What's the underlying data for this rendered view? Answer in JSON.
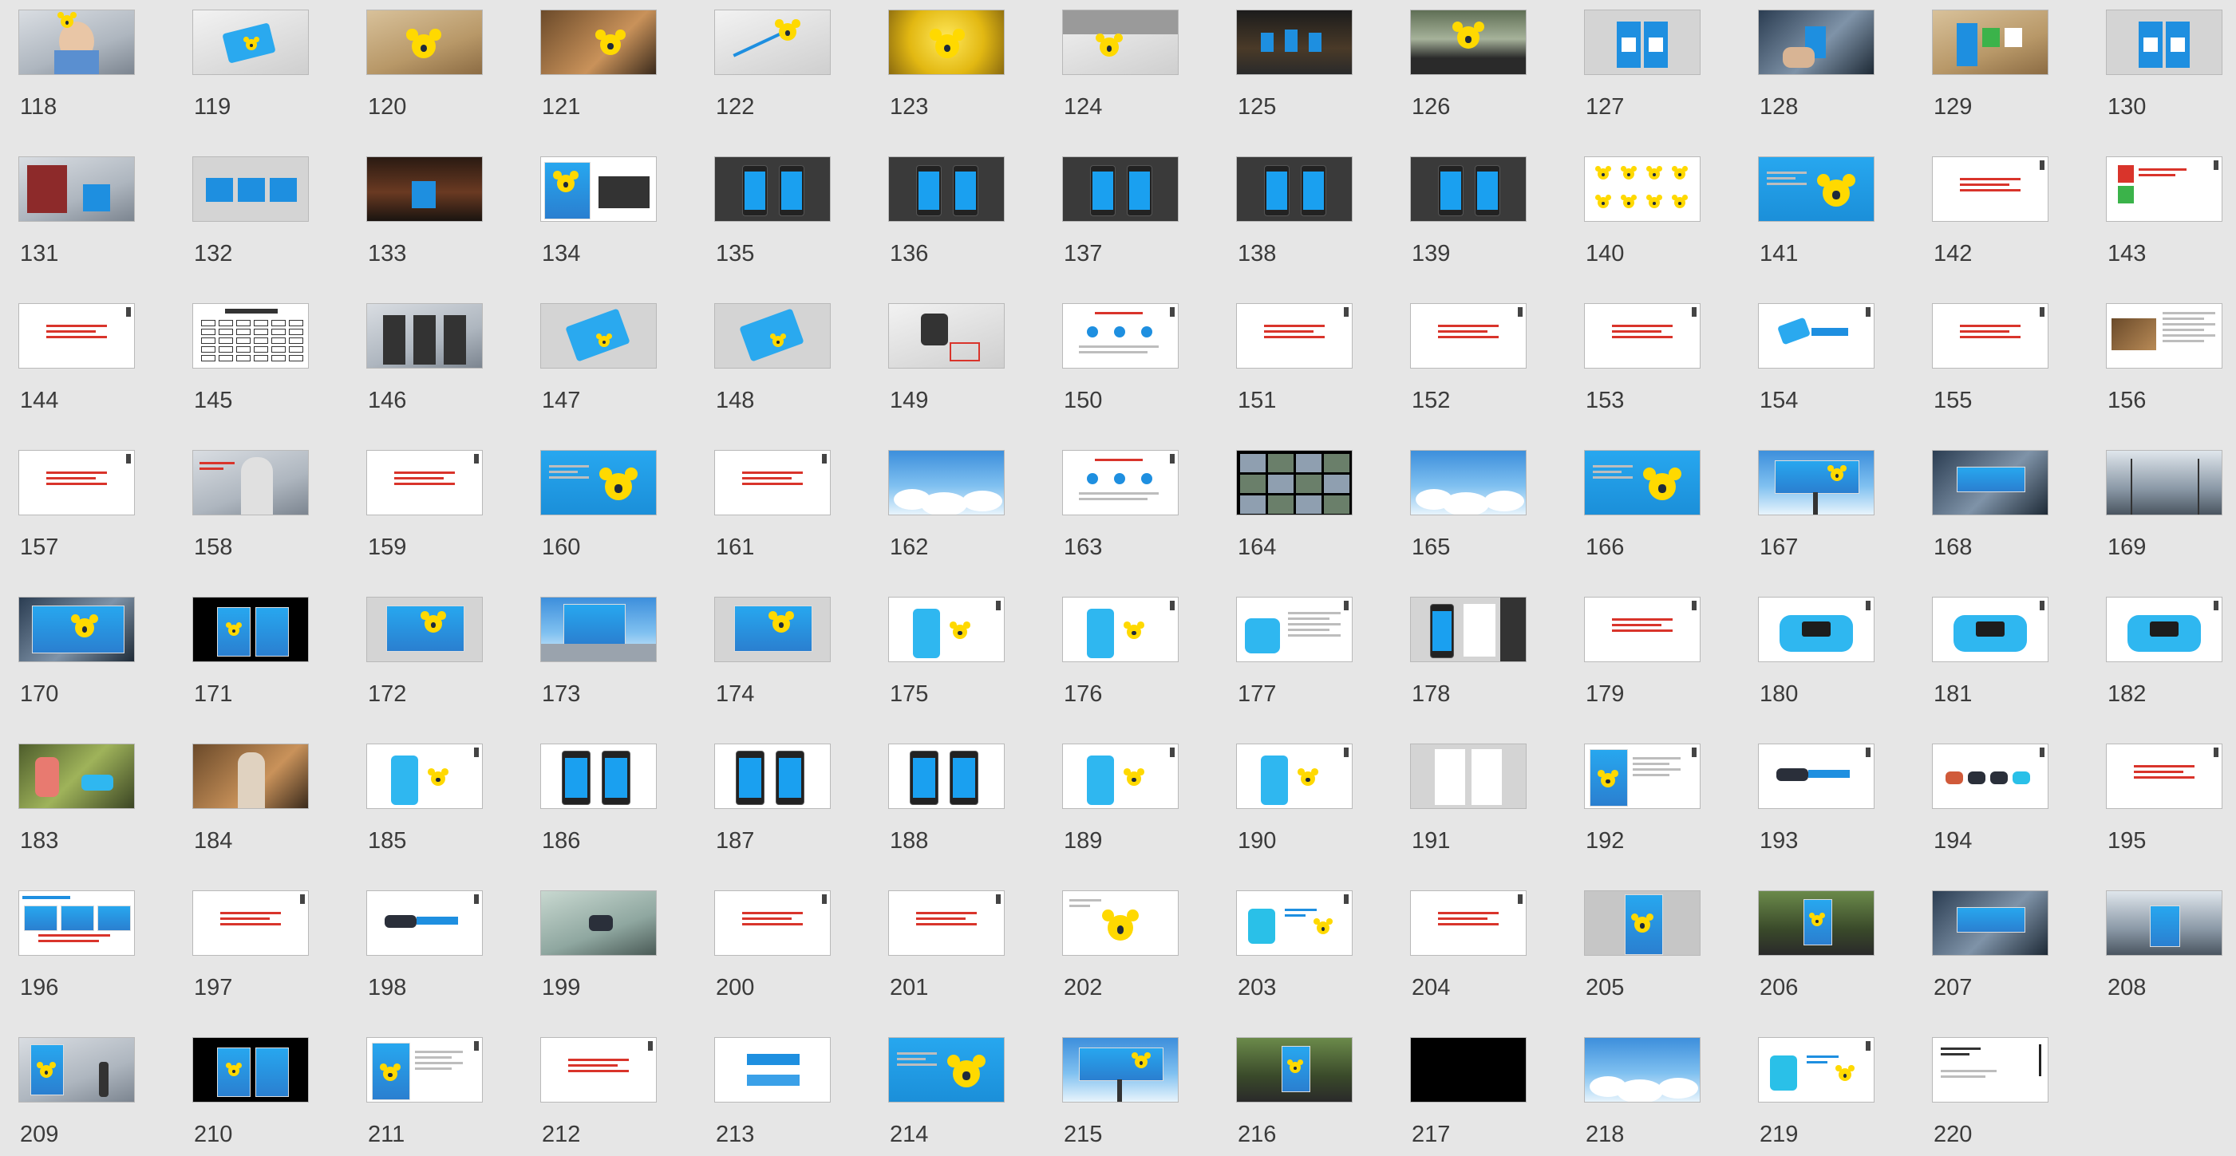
{
  "slides": [
    {
      "num": "118",
      "kind": "photo-girl"
    },
    {
      "num": "119",
      "kind": "card-desk"
    },
    {
      "num": "120",
      "kind": "keychain-wood"
    },
    {
      "num": "121",
      "kind": "keychain-warm"
    },
    {
      "num": "122",
      "kind": "keychain-desk"
    },
    {
      "num": "123",
      "kind": "yellow-glow"
    },
    {
      "num": "124",
      "kind": "keychain-laptop"
    },
    {
      "num": "125",
      "kind": "counter-dark"
    },
    {
      "num": "126",
      "kind": "car-dash"
    },
    {
      "num": "127",
      "kind": "qr-stand"
    },
    {
      "num": "128",
      "kind": "photo-hand"
    },
    {
      "num": "129",
      "kind": "qr-stand-wood"
    },
    {
      "num": "130",
      "kind": "qr-stand"
    },
    {
      "num": "131",
      "kind": "photo-store"
    },
    {
      "num": "132",
      "kind": "push-pull"
    },
    {
      "num": "133",
      "kind": "photo-dark"
    },
    {
      "num": "134",
      "kind": "poster-laptop"
    },
    {
      "num": "135",
      "kind": "phones-dark"
    },
    {
      "num": "136",
      "kind": "phones-dark"
    },
    {
      "num": "137",
      "kind": "phones-dark"
    },
    {
      "num": "138",
      "kind": "phones-dark"
    },
    {
      "num": "139",
      "kind": "phones-dark"
    },
    {
      "num": "140",
      "kind": "koalas-white"
    },
    {
      "num": "141",
      "kind": "koala-blue"
    },
    {
      "num": "142",
      "kind": "text-white"
    },
    {
      "num": "143",
      "kind": "arrows-white"
    },
    {
      "num": "144",
      "kind": "text-white"
    },
    {
      "num": "145",
      "kind": "org-chart"
    },
    {
      "num": "146",
      "kind": "atm-photo"
    },
    {
      "num": "147",
      "kind": "card-grey"
    },
    {
      "num": "148",
      "kind": "card-grey"
    },
    {
      "num": "149",
      "kind": "stamp"
    },
    {
      "num": "150",
      "kind": "diagram-white"
    },
    {
      "num": "151",
      "kind": "text-white"
    },
    {
      "num": "152",
      "kind": "text-white"
    },
    {
      "num": "153",
      "kind": "text-white"
    },
    {
      "num": "154",
      "kind": "card-white"
    },
    {
      "num": "155",
      "kind": "text-white"
    },
    {
      "num": "156",
      "kind": "photo-text"
    },
    {
      "num": "157",
      "kind": "text-white"
    },
    {
      "num": "158",
      "kind": "photo-woman"
    },
    {
      "num": "159",
      "kind": "text-white"
    },
    {
      "num": "160",
      "kind": "koala-blue"
    },
    {
      "num": "161",
      "kind": "text-white"
    },
    {
      "num": "162",
      "kind": "sky"
    },
    {
      "num": "163",
      "kind": "diagram-white"
    },
    {
      "num": "164",
      "kind": "grid-photos"
    },
    {
      "num": "165",
      "kind": "sky"
    },
    {
      "num": "166",
      "kind": "koala-blue"
    },
    {
      "num": "167",
      "kind": "billboard"
    },
    {
      "num": "168",
      "kind": "billboard-indoor"
    },
    {
      "num": "169",
      "kind": "corridor"
    },
    {
      "num": "170",
      "kind": "lightbox"
    },
    {
      "num": "171",
      "kind": "lightbox-dark"
    },
    {
      "num": "172",
      "kind": "poster-wall"
    },
    {
      "num": "173",
      "kind": "building"
    },
    {
      "num": "174",
      "kind": "poster-wall"
    },
    {
      "num": "175",
      "kind": "pos-white"
    },
    {
      "num": "176",
      "kind": "pos-white"
    },
    {
      "num": "177",
      "kind": "pos-text"
    },
    {
      "num": "178",
      "kind": "phones-grey"
    },
    {
      "num": "179",
      "kind": "text-white"
    },
    {
      "num": "180",
      "kind": "device-white"
    },
    {
      "num": "181",
      "kind": "device-white"
    },
    {
      "num": "182",
      "kind": "device-white"
    },
    {
      "num": "183",
      "kind": "photo-green"
    },
    {
      "num": "184",
      "kind": "photo-shop"
    },
    {
      "num": "185",
      "kind": "pos-white"
    },
    {
      "num": "186",
      "kind": "phones-white"
    },
    {
      "num": "187",
      "kind": "phones-white"
    },
    {
      "num": "188",
      "kind": "phones-white"
    },
    {
      "num": "189",
      "kind": "pos-white"
    },
    {
      "num": "190",
      "kind": "pos-white"
    },
    {
      "num": "191",
      "kind": "doc-grey"
    },
    {
      "num": "192",
      "kind": "poster-text"
    },
    {
      "num": "193",
      "kind": "band-white"
    },
    {
      "num": "194",
      "kind": "bands-white"
    },
    {
      "num": "195",
      "kind": "text-white"
    },
    {
      "num": "196",
      "kind": "collage"
    },
    {
      "num": "197",
      "kind": "text-white"
    },
    {
      "num": "198",
      "kind": "band-white"
    },
    {
      "num": "199",
      "kind": "photo-band"
    },
    {
      "num": "200",
      "kind": "text-white"
    },
    {
      "num": "201",
      "kind": "text-white"
    },
    {
      "num": "202",
      "kind": "koala-white"
    },
    {
      "num": "203",
      "kind": "band-koala"
    },
    {
      "num": "204",
      "kind": "text-white"
    },
    {
      "num": "205",
      "kind": "poster-grey"
    },
    {
      "num": "206",
      "kind": "bus-stop"
    },
    {
      "num": "207",
      "kind": "billboard-indoor"
    },
    {
      "num": "208",
      "kind": "corridor-poster"
    },
    {
      "num": "209",
      "kind": "subway"
    },
    {
      "num": "210",
      "kind": "lightbox-dark"
    },
    {
      "num": "211",
      "kind": "poster-text"
    },
    {
      "num": "212",
      "kind": "text-white"
    },
    {
      "num": "213",
      "kind": "logo-white"
    },
    {
      "num": "214",
      "kind": "koala-blue"
    },
    {
      "num": "215",
      "kind": "billboard"
    },
    {
      "num": "216",
      "kind": "bus-stop"
    },
    {
      "num": "217",
      "kind": "black"
    },
    {
      "num": "218",
      "kind": "sky"
    },
    {
      "num": "219",
      "kind": "band-koala"
    },
    {
      "num": "220",
      "kind": "end-white"
    }
  ],
  "colors": {
    "background": "#e6e6e6",
    "brand_blue": "#1e9be8",
    "brand_yellow": "#ffd900",
    "accent_red": "#d9342b"
  }
}
